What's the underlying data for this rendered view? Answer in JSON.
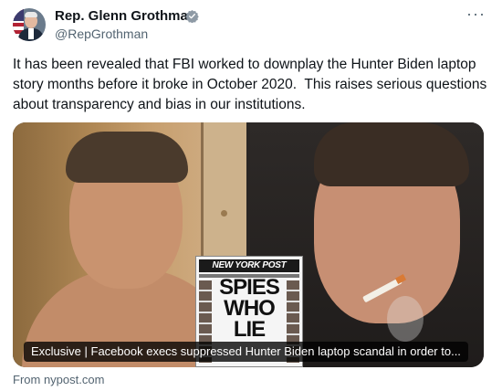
{
  "author": {
    "display_name": "Rep. Glenn Grothman",
    "handle": "@RepGrothman",
    "verified_icon": "verified-badge-icon",
    "verified_color": "#8e9aa5"
  },
  "menu": {
    "more_label": "···"
  },
  "tweet": {
    "text": "It has been revealed that FBI worked to downplay the Hunter Biden laptop story months before it broke in October 2020.  This raises serious questions about transparency and bias in our institutions."
  },
  "link_card": {
    "newspaper_masthead": "NEW YORK POST",
    "newspaper_headline": "SPIES WHO LIE",
    "caption": "Exclusive | Facebook execs suppressed Hunter Biden laptop scandal in order to...",
    "source": "From nypost.com"
  }
}
